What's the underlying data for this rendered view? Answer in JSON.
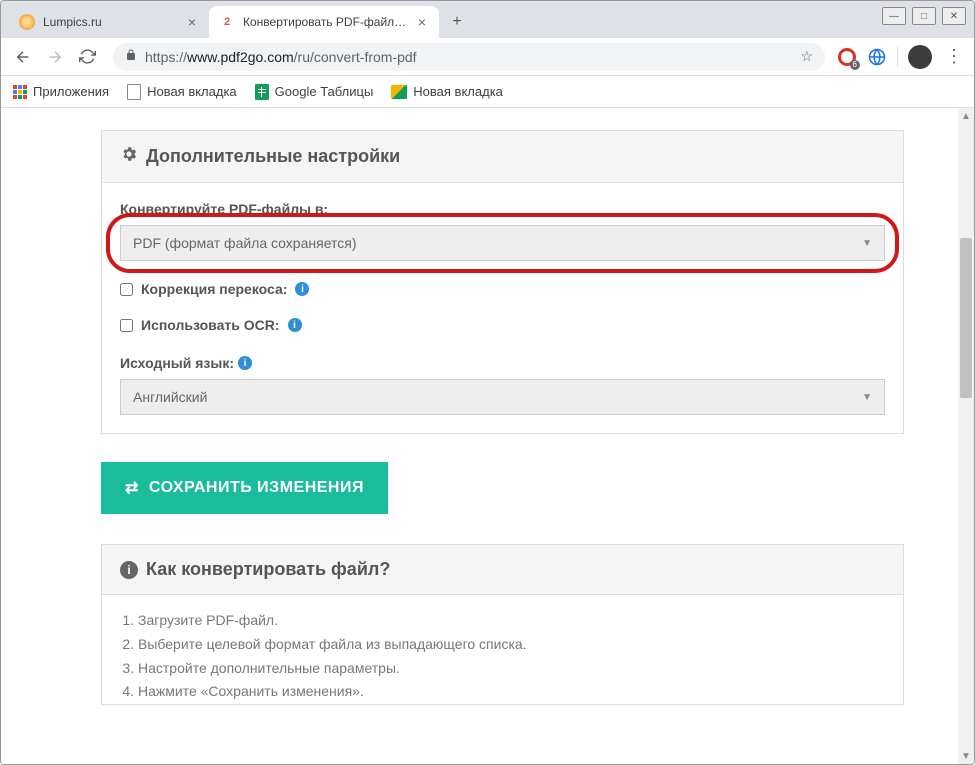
{
  "tabs": [
    {
      "title": "Lumpics.ru"
    },
    {
      "title": "Конвертировать PDF-файл — К"
    }
  ],
  "url": {
    "scheme": "https://",
    "host": "www.pdf2go.com",
    "path": "/ru/convert-from-pdf"
  },
  "bookmarks": {
    "apps": "Приложения",
    "new_tab1": "Новая вкладка",
    "sheets": "Google Таблицы",
    "new_tab2": "Новая вкладка"
  },
  "ext_badge": "6",
  "settings_panel": {
    "title": "Дополнительные настройки",
    "convert_label": "Конвертируйте PDF-файлы в:",
    "convert_value": "PDF (формат файла сохраняется)",
    "deskew": "Коррекция перекоса:",
    "ocr": "Использовать OCR:",
    "lang_label": "Исходный язык:",
    "lang_value": "Английский"
  },
  "save_button": "СОХРАНИТЬ ИЗМЕНЕНИЯ",
  "help": {
    "title": "Как конвертировать файл?",
    "steps": [
      "Загрузите PDF-файл.",
      "Выберите целевой формат файла из выпадающего списка.",
      "Настройте дополнительные параметры.",
      "Нажмите «Сохранить изменения»."
    ]
  }
}
